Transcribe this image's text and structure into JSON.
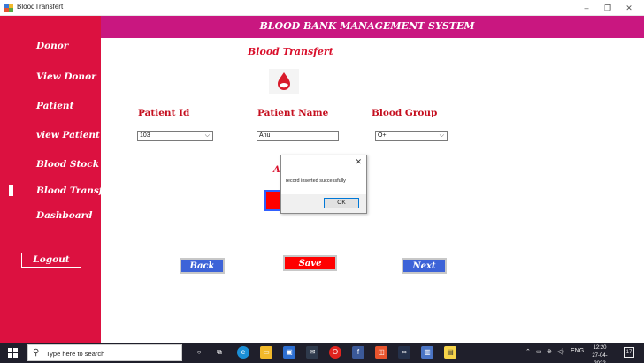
{
  "window": {
    "title": "BloodTransfert",
    "minimize": "–",
    "restore": "❐",
    "close": "✕"
  },
  "header": {
    "title": "BLOOD BANK MANAGEMENT SYSTEM"
  },
  "sidebar": {
    "items": [
      {
        "label": "Donor"
      },
      {
        "label": "View Donor"
      },
      {
        "label": "Patient"
      },
      {
        "label": "view Patient"
      },
      {
        "label": "Blood Stock"
      },
      {
        "label": "Blood Transfert",
        "active": true
      },
      {
        "label": "Dashboard"
      }
    ],
    "logout": "Logout"
  },
  "page": {
    "title": "Blood Transfert",
    "labels": {
      "patient_id": "Patient Id",
      "patient_name": "Patient Name",
      "blood_group": "Blood Group"
    },
    "fields": {
      "patient_id": "103",
      "patient_name": "Anu",
      "blood_group": "O+"
    },
    "partial_label": "A",
    "buttons": {
      "back": "Back",
      "save": "Save",
      "next": "Next"
    }
  },
  "dialog": {
    "message": "record inserted successfully",
    "ok": "OK",
    "close": "✕"
  },
  "taskbar": {
    "search_placeholder": "Type here to search",
    "lang": "ENG",
    "time": "12:20",
    "date": "27-04-2022",
    "notifications": "17"
  },
  "colors": {
    "sidebar": "#dc1140",
    "header": "#c91780",
    "accent_text": "#d9102c",
    "blue_button": "#3d63d8",
    "save_button": "#ff0000"
  }
}
